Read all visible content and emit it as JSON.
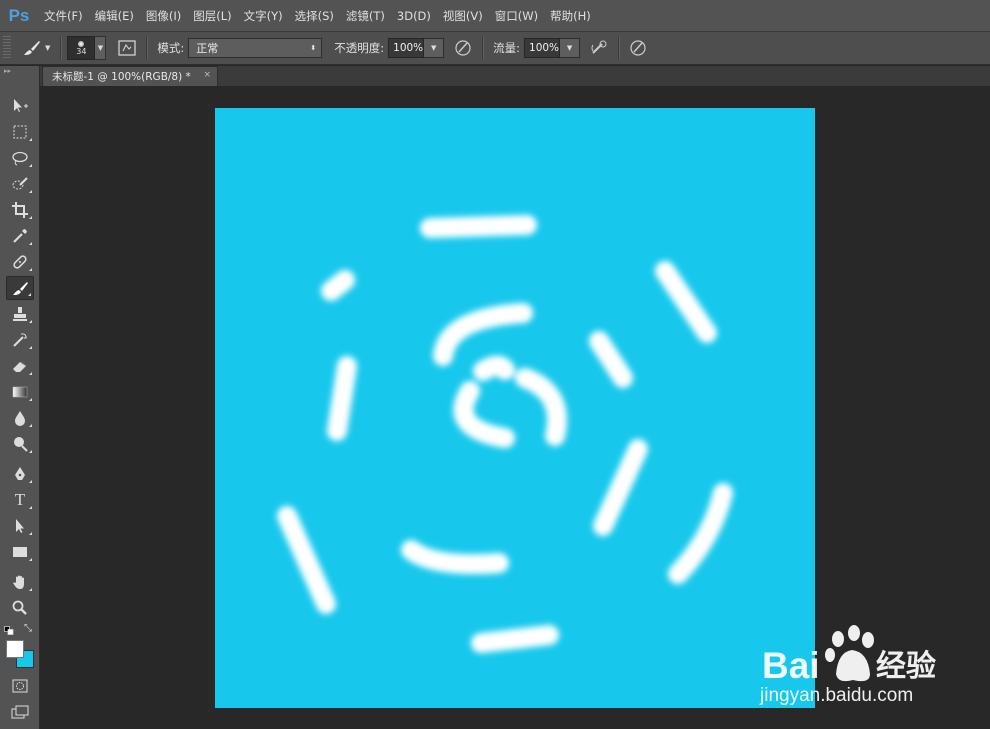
{
  "app": {
    "logo": "Ps"
  },
  "menu": [
    "文件(F)",
    "编辑(E)",
    "图像(I)",
    "图层(L)",
    "文字(Y)",
    "选择(S)",
    "滤镜(T)",
    "3D(D)",
    "视图(V)",
    "窗口(W)",
    "帮助(H)"
  ],
  "options": {
    "brush_size": "34",
    "mode_label": "模式:",
    "mode_value": "正常",
    "opacity_label": "不透明度:",
    "opacity_value": "100%",
    "flow_label": "流量:",
    "flow_value": "100%"
  },
  "document": {
    "tab_title": "未标题-1 @ 100%(RGB/8) *",
    "close_symbol": "×",
    "canvas_color": "#17c8ec",
    "stroke_color": "#ffffff"
  },
  "toolbox": {
    "tools": [
      "move-tool",
      "marquee-tool",
      "lasso-tool",
      "quick-select-tool",
      "crop-tool",
      "eyedropper-tool",
      "healing-brush-tool",
      "brush-tool",
      "clone-stamp-tool",
      "history-brush-tool",
      "eraser-tool",
      "gradient-tool",
      "blur-tool",
      "dodge-tool",
      "pen-tool",
      "type-tool",
      "path-select-tool",
      "rectangle-tool",
      "hand-tool",
      "zoom-tool"
    ],
    "type_tool_glyph": "T",
    "foreground_color": "#ffffff",
    "background_color": "#17c8ec"
  },
  "watermark": {
    "brand_left": "Bai",
    "brand_right": "经验",
    "url": "jingyan.baidu.com"
  }
}
